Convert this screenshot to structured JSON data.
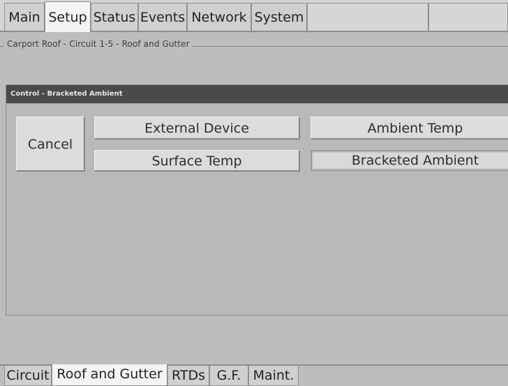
{
  "top_tabs": [
    {
      "label": "Main"
    },
    {
      "label": "Setup",
      "active": true
    },
    {
      "label": "Status"
    },
    {
      "label": "Events"
    },
    {
      "label": "Network"
    },
    {
      "label": "System"
    }
  ],
  "breadcrumb": "Carport Roof - Circuit 1-5 - Roof and Gutter",
  "dialog": {
    "title": "Control - Bracketed Ambient",
    "cancel_label": "Cancel",
    "options": {
      "external_device": "External Device",
      "ambient_temp": "Ambient Temp",
      "surface_temp": "Surface Temp",
      "bracketed_ambient": "Bracketed Ambient"
    },
    "selected_option": "Bracketed Ambient"
  },
  "bottom_tabs": [
    {
      "label": "Circuit"
    },
    {
      "label": "Roof and Gutter",
      "active": true
    },
    {
      "label": "RTDs"
    },
    {
      "label": "G.F."
    },
    {
      "label": "Maint."
    }
  ]
}
